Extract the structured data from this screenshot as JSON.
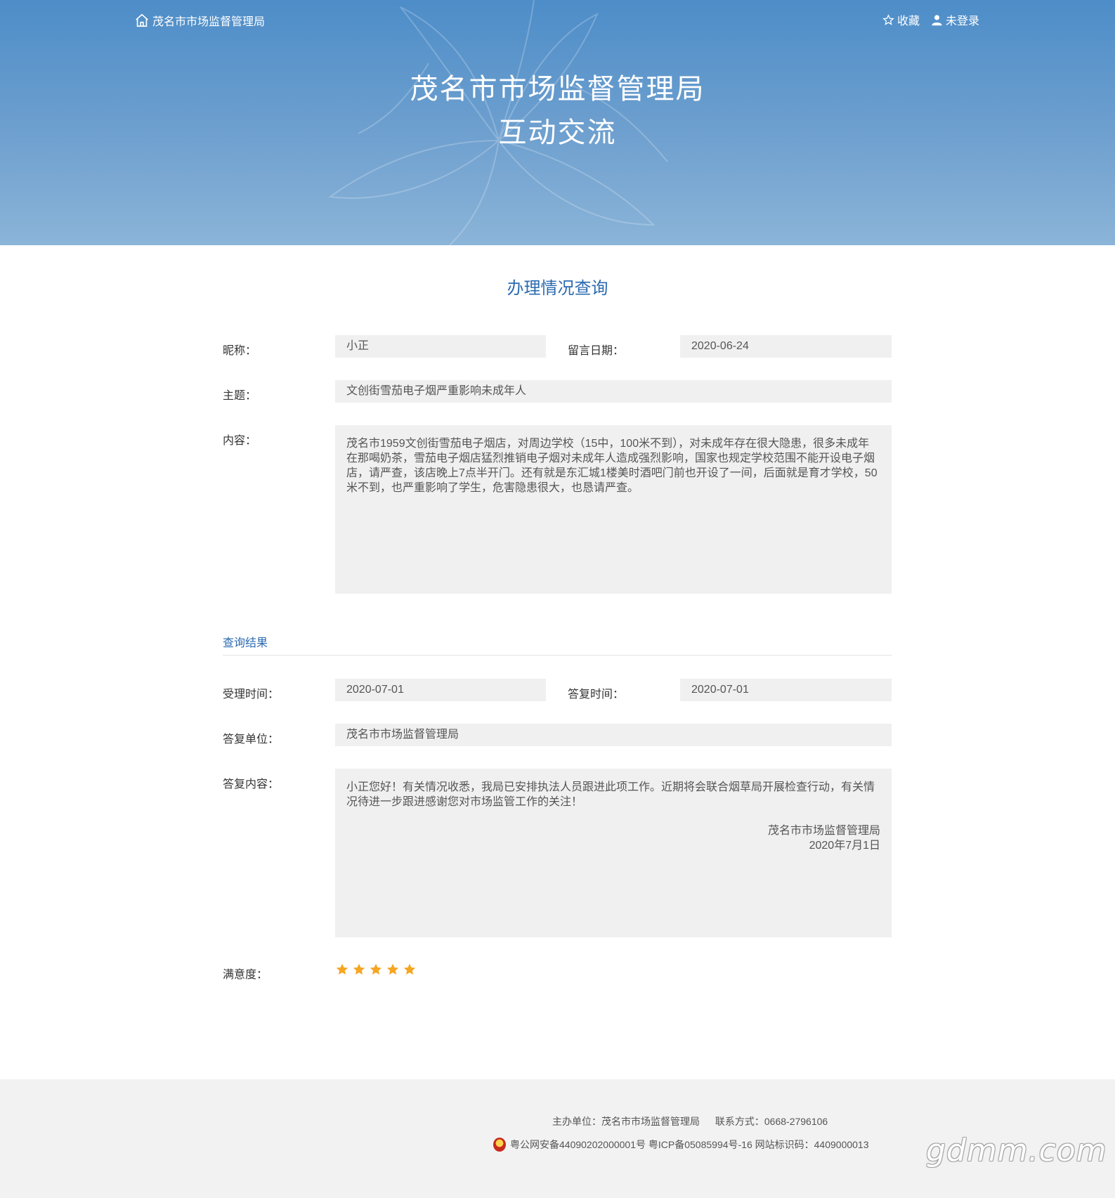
{
  "header": {
    "home_label": "茂名市市场监督管理局",
    "favorite_label": "收藏",
    "login_label": "未登录",
    "title_line1": "茂名市市场监督管理局",
    "title_line2": "互动交流"
  },
  "page": {
    "heading": "办理情况查询"
  },
  "message": {
    "nickname_label": "昵称：",
    "nickname": "小正",
    "date_label": "留言日期：",
    "date": "2020-06-24",
    "subject_label": "主题：",
    "subject": "文创街雪茄电子烟严重影响未成年人",
    "content_label": "内容：",
    "content": "茂名市1959文创街雪茄电子烟店，对周边学校（15中，100米不到），对未成年存在很大隐患，很多未成年在那喝奶茶，雪茄电子烟店猛烈推销电子烟对未成年人造成强烈影响，国家也规定学校范围不能开设电子烟店，请严查，该店晚上7点半开门。还有就是东汇城1楼美时酒吧门前也开设了一间，后面就是育才学校，50米不到，也严重影响了学生，危害隐患很大，也恳请严查。"
  },
  "result": {
    "section_title": "查询结果",
    "accept_time_label": "受理时间：",
    "accept_time": "2020-07-01",
    "reply_time_label": "答复时间：",
    "reply_time": "2020-07-01",
    "reply_unit_label": "答复单位：",
    "reply_unit": "茂名市市场监督管理局",
    "reply_content_label": "答复内容：",
    "reply_content": "小正您好！有关情况收悉，我局已安排执法人员跟进此项工作。近期将会联合烟草局开展检查行动，有关情况待进一步跟进感谢您对市场监管工作的关注！",
    "reply_signature_org": "茂名市市场监督管理局",
    "reply_signature_date": "2020年7月1日",
    "satisfaction_label": "满意度：",
    "satisfaction_stars": 5,
    "satisfaction_max": 5,
    "star_color": "#f5a623"
  },
  "footer": {
    "sponsor": "主办单位：茂名市市场监督管理局",
    "contact": "联系方式：0668-2796106",
    "records": "粤公网安备44090202000001号 粤ICP备05085994号-16 网站标识码：4409000013",
    "watermark": "gdmm.com"
  },
  "colors": {
    "accent": "#2c6bb0",
    "banner_top": "#4d8dc8",
    "banner_bottom": "#8bb4d8",
    "field_bg": "#f0f0f0"
  },
  "icons": {
    "home": "home-icon",
    "favorite": "star-outline-icon",
    "login": "user-icon",
    "police_badge": "police-badge-icon"
  }
}
